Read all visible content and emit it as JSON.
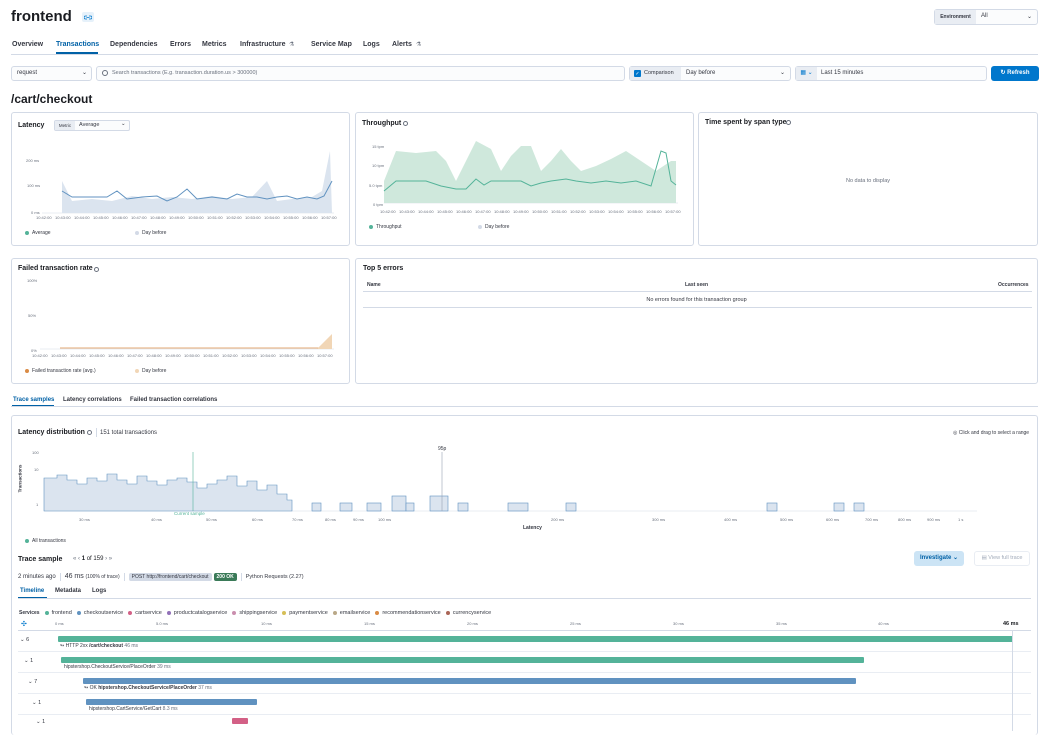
{
  "service": {
    "name": "frontend"
  },
  "environment": {
    "label": "Environment",
    "value": "All"
  },
  "nav": {
    "tabs": [
      {
        "label": "Overview"
      },
      {
        "label": "Transactions"
      },
      {
        "label": "Dependencies"
      },
      {
        "label": "Errors"
      },
      {
        "label": "Metrics"
      },
      {
        "label": "Infrastructure"
      },
      {
        "label": "Service Map"
      },
      {
        "label": "Logs"
      },
      {
        "label": "Alerts"
      }
    ]
  },
  "filters": {
    "transaction_type": "request",
    "search_placeholder": "Search transactions (E.g. transaction.duration.us > 300000)",
    "comparison_label": "Comparison",
    "comparison_value": "Day before",
    "time_range": "Last 15 minutes",
    "refresh_label": "Refresh"
  },
  "page_title": "/cart/checkout",
  "latency": {
    "title": "Latency",
    "metric_label": "Metric",
    "metric_value": "Average",
    "legend": [
      "Average",
      "Day before"
    ],
    "y_ticks": [
      "200 ms",
      "100 ms",
      "0 ms"
    ]
  },
  "throughput": {
    "title": "Throughput",
    "legend": [
      "Throughput",
      "Day before"
    ],
    "y_ticks": [
      "15 tpm",
      "10 tpm",
      "5.0 tpm",
      "0 tpm"
    ]
  },
  "span_type": {
    "title": "Time spent by span type",
    "empty": "No data to display"
  },
  "failed_rate": {
    "title": "Failed transaction rate",
    "legend": [
      "Failed transaction rate (avg.)",
      "Day before"
    ],
    "y_ticks": [
      "100%",
      "50%",
      "0%"
    ]
  },
  "time_ticks": [
    "10:42:00",
    "10:43:00",
    "10:44:00",
    "10:45:00",
    "10:46:00",
    "10:47:00",
    "10:48:00",
    "10:49:00",
    "10:50:00",
    "10:51:00",
    "10:52:00",
    "10:53:00",
    "10:54:00",
    "10:55:00",
    "10:56:00",
    "10:57:00"
  ],
  "top_errors": {
    "title": "Top 5 errors",
    "columns": [
      "Name",
      "Last seen",
      "Occurrences"
    ],
    "empty": "No errors found for this transaction group"
  },
  "sub_tabs": [
    "Trace samples",
    "Latency correlations",
    "Failed transaction correlations"
  ],
  "distribution": {
    "title": "Latency distribution",
    "total": "151 total transactions",
    "hint": "Click and drag to select a range",
    "percentile_label": "95p",
    "current_sample_label": "Current sample",
    "y_label": "Transactions",
    "x_label": "Latency",
    "y_ticks": [
      "100",
      "10",
      "1"
    ],
    "x_ticks": [
      "30 ms",
      "40 ms",
      "50 ms",
      "60 ms",
      "70 ms",
      "80 ms",
      "90 ms",
      "100 ms",
      "200 ms",
      "300 ms",
      "400 ms",
      "500 ms",
      "600 ms",
      "700 ms",
      "800 ms",
      "900 ms",
      "1 s"
    ],
    "legend": "All transactions"
  },
  "trace_sample": {
    "title": "Trace sample",
    "pager": "1 of 159",
    "pager_current": "1",
    "pager_of": "of",
    "pager_total": "159",
    "investigate": "Investigate",
    "view_full_trace": "View full trace",
    "age": "2 minutes ago",
    "duration": "46 ms",
    "percent": "(100% of trace)",
    "request": "POST http://frontend/cart/checkout",
    "status": "200 OK",
    "agent": "Python Requests (2.27)",
    "tabs": [
      "Timeline",
      "Metadata",
      "Logs"
    ]
  },
  "services": {
    "label": "Services",
    "items": [
      {
        "name": "frontend",
        "color": "#54b399"
      },
      {
        "name": "checkoutservice",
        "color": "#6092c0"
      },
      {
        "name": "cartservice",
        "color": "#d36086"
      },
      {
        "name": "productcatalogservice",
        "color": "#9170b8"
      },
      {
        "name": "shippingservice",
        "color": "#ca8eae"
      },
      {
        "name": "paymentservice",
        "color": "#d6bf57"
      },
      {
        "name": "emailservice",
        "color": "#b9a888"
      },
      {
        "name": "recommendationservice",
        "color": "#da8b45"
      },
      {
        "name": "currencyservice",
        "color": "#aa6556"
      }
    ]
  },
  "timeline_ticks": [
    "0 ms",
    "5.0 ms",
    "10 ms",
    "15 ms",
    "20 ms",
    "25 ms",
    "30 ms",
    "35 ms",
    "40 ms",
    "46 ms"
  ],
  "waterfall": [
    {
      "count": "6",
      "prefix": "HTTP 2xx",
      "name": "/cart/checkout",
      "duration": "46 ms"
    },
    {
      "count": "1",
      "prefix": "",
      "name": "hipstershop.CheckoutService/PlaceOrder",
      "duration": "39 ms"
    },
    {
      "count": "7",
      "prefix": "OK",
      "name": "hipstershop.CheckoutService/PlaceOrder",
      "duration": "37 ms"
    },
    {
      "count": "1",
      "prefix": "",
      "name": "hipstershop.CartService/GetCart",
      "duration": "8.3 ms"
    },
    {
      "count": "1",
      "prefix": "",
      "name": "",
      "duration": ""
    }
  ],
  "colors": {
    "accent": "#0061a6",
    "primary_btn": "#0077cc",
    "success": "#3a7a58"
  }
}
